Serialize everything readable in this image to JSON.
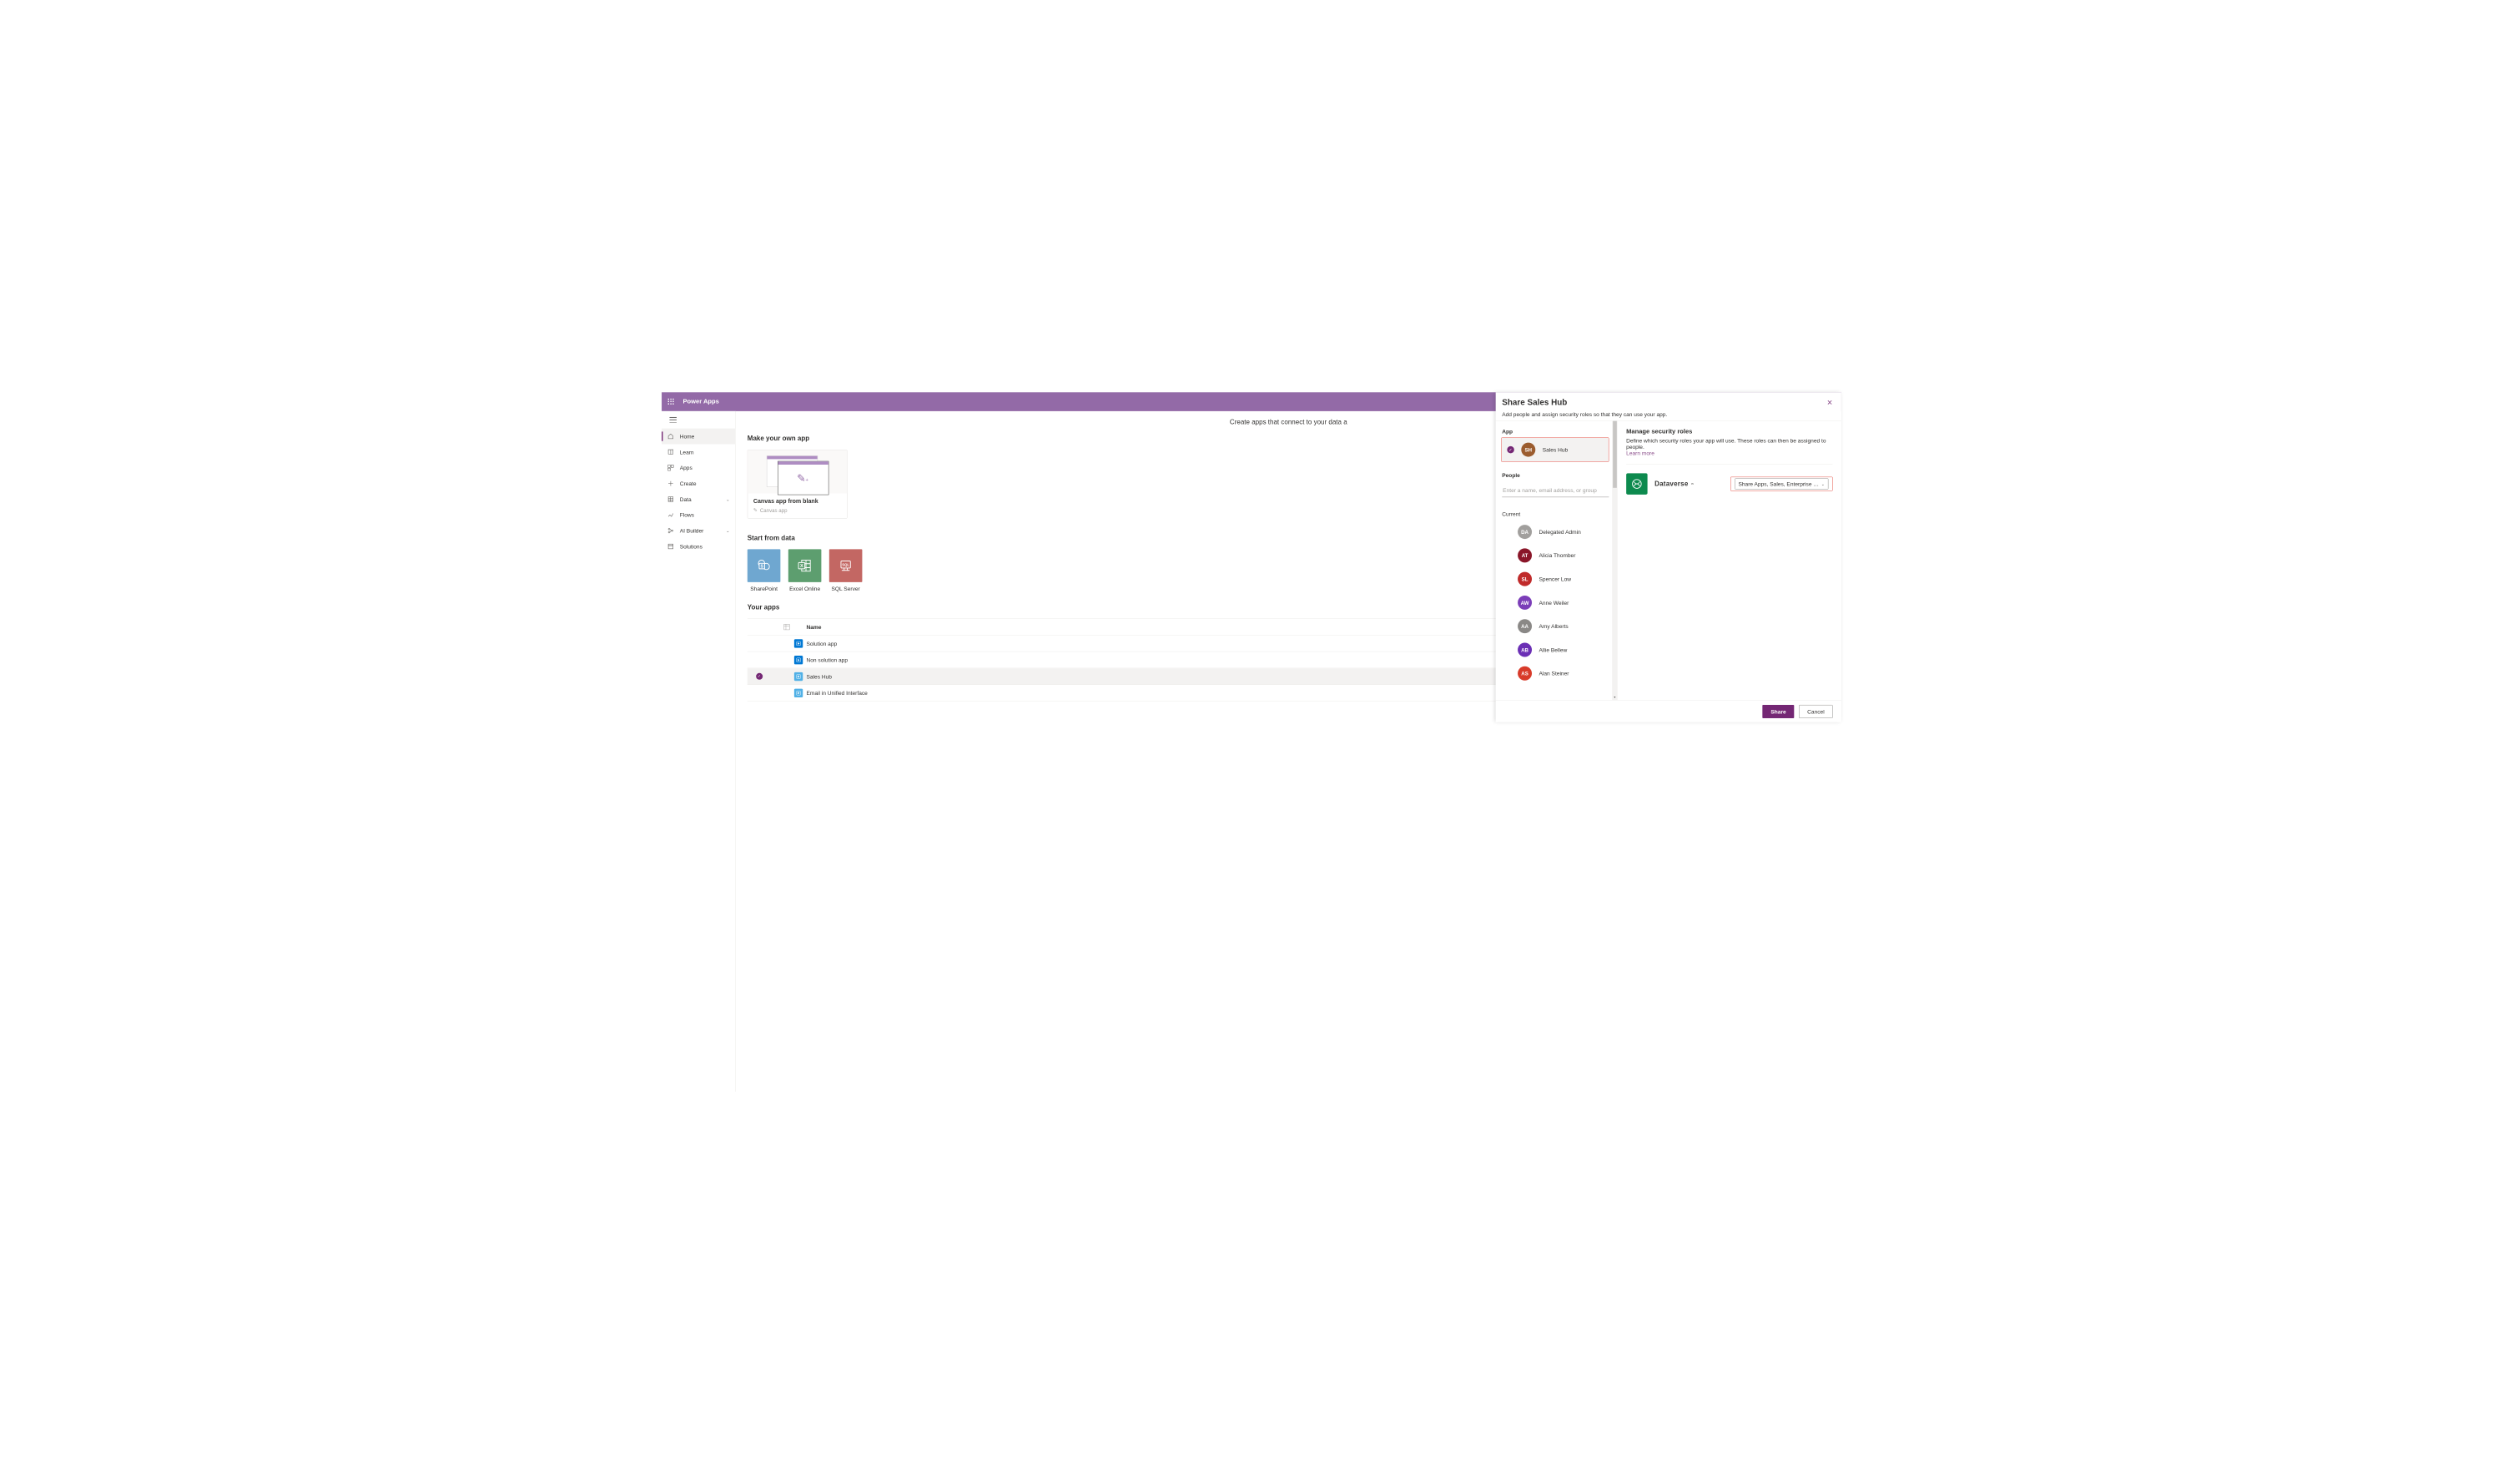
{
  "brand": "Power Apps",
  "hero": "Create apps that connect to your data a",
  "nav": [
    {
      "label": "Home",
      "icon": "home",
      "selected": true,
      "chev": false
    },
    {
      "label": "Learn",
      "icon": "book",
      "selected": false,
      "chev": false
    },
    {
      "label": "Apps",
      "icon": "apps",
      "selected": false,
      "chev": false
    },
    {
      "label": "Create",
      "icon": "plus",
      "selected": false,
      "chev": false
    },
    {
      "label": "Data",
      "icon": "data",
      "selected": false,
      "chev": true
    },
    {
      "label": "Flows",
      "icon": "flow",
      "selected": false,
      "chev": false
    },
    {
      "label": "AI Builder",
      "icon": "ai",
      "selected": false,
      "chev": true
    },
    {
      "label": "Solutions",
      "icon": "sol",
      "selected": false,
      "chev": false
    }
  ],
  "sections": {
    "make": "Make your own app",
    "start": "Start from data",
    "yours": "Your apps"
  },
  "card": {
    "title": "Canvas app from blank",
    "sub": "Canvas app"
  },
  "dataSources": [
    {
      "label": "SharePoint",
      "color": "#6fa7d0"
    },
    {
      "label": "Excel Online",
      "color": "#5d9e6f"
    },
    {
      "label": "SQL Server",
      "color": "#c36763"
    }
  ],
  "list": {
    "nameHeader": "Name",
    "rows": [
      {
        "name": "Solution app",
        "color": "#0078d4",
        "kind": "ma",
        "selected": false
      },
      {
        "name": "Non solution app",
        "color": "#0078d4",
        "kind": "ma",
        "selected": false
      },
      {
        "name": "Sales Hub",
        "color": "#50b0e6",
        "kind": "ma",
        "selected": true
      },
      {
        "name": "Email in Unified Interface",
        "color": "#50b0e6",
        "kind": "ma",
        "selected": false
      }
    ]
  },
  "share": {
    "title": "Share Sales Hub",
    "subtitle": "Add people and assign security roles so that they can use your app.",
    "appLabel": "App",
    "appName": "Sales Hub",
    "appInitials": "SH",
    "appColor": "#9b5c2e",
    "peopleLabel": "People",
    "peoplePlaceholder": "Enter a name, email address, or group",
    "currentLabel": "Current",
    "people": [
      {
        "initials": "DA",
        "name": "Delegated Admin",
        "color": "#a19f9d"
      },
      {
        "initials": "AT",
        "name": "Alicia Thomber",
        "color": "#8a1629"
      },
      {
        "initials": "SL",
        "name": "Spencer Low",
        "color": "#c02a2a"
      },
      {
        "initials": "AW",
        "name": "Anne Weiler",
        "color": "#7b3db8"
      },
      {
        "initials": "AA",
        "name": "Amy Alberts",
        "color": "#8a8886"
      },
      {
        "initials": "AB",
        "name": "Allie Bellew",
        "color": "#6b2fb5"
      },
      {
        "initials": "AS",
        "name": "Alan Steiner",
        "color": "#d83b2a"
      }
    ],
    "rolesTitle": "Manage security roles",
    "rolesSub": "Define which security roles your app will use. These roles can then be assigned to people.",
    "learnMore": "Learn more",
    "dataverse": "Dataverse",
    "rolesValue": "Share Apps, Sales, Enterprise app a…",
    "shareBtn": "Share",
    "cancelBtn": "Cancel"
  }
}
